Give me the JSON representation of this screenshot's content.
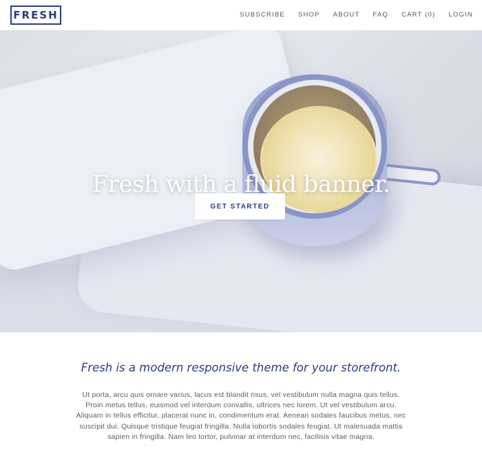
{
  "header": {
    "logo": "FRESH",
    "nav": [
      "SUBSCRIBE",
      "SHOP",
      "ABOUT",
      "FAQ",
      "CART (0)",
      "LOGIN"
    ]
  },
  "hero": {
    "title": "Fresh with a fluid banner.",
    "cta_label": "GET STARTED"
  },
  "main": {
    "tagline": "Fresh is a modern responsive theme for your storefront.",
    "body": "Ut porta, arcu quis ornare varius, lacus est blandit risus, vel vestibulum nulla magna quis tellus. Proin metus tellus, euismod vel interdum convallis, ultrices nec lorem. Ut vel vestibulum arcu. Aliquam in tellus efficitur, placerat nunc in, condimentum erat. Aenean sodales faucibus metus, nec suscipit dui. Quisque tristique feugiat fringilla. Nulla lobortis sodales feugiat. Ut malesuada mattis sapien in fringilla. Nam leo tortor, pulvinar at interdum nec, facilisis vitae magna."
  },
  "colors": {
    "brand": "#2c3a84",
    "text": "#5c5c5c",
    "nav_text": "#555555"
  }
}
